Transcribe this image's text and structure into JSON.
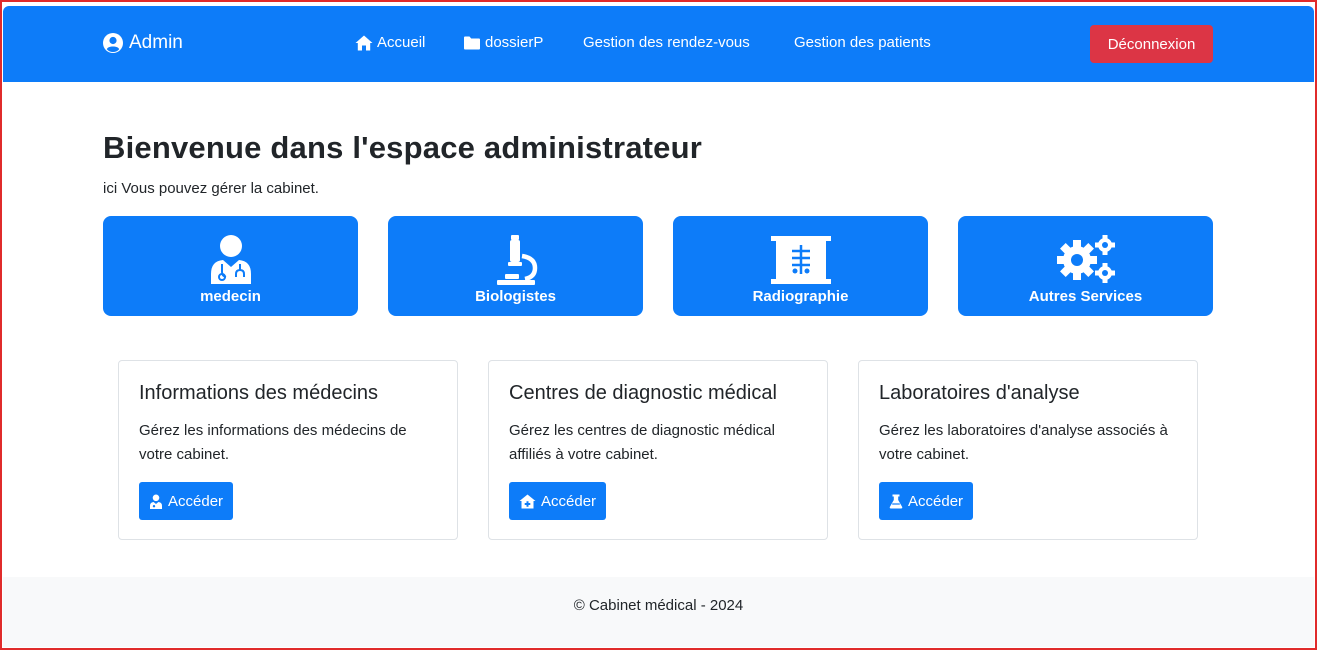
{
  "navbar": {
    "brand": "Admin",
    "links": [
      {
        "label": "Accueil",
        "icon": "home-icon"
      },
      {
        "label": "dossierP",
        "icon": "folder-icon"
      },
      {
        "label": "Gestion des rendez-vous"
      },
      {
        "label": "Gestion des patients"
      }
    ],
    "logout_label": "Déconnexion"
  },
  "main": {
    "title": "Bienvenue dans l'espace administrateur",
    "subtitle": "ici Vous pouvez gérer la cabinet."
  },
  "tiles": [
    {
      "label": "medecin",
      "icon": "doctor-icon"
    },
    {
      "label": "Biologistes",
      "icon": "microscope-icon"
    },
    {
      "label": "Radiographie",
      "icon": "x-ray-icon"
    },
    {
      "label": "Autres Services",
      "icon": "gears-icon"
    }
  ],
  "cards": [
    {
      "title": "Informations des médecins",
      "text": "Gérez les informations des médecins de votre cabinet.",
      "button": "Accéder",
      "icon": "user-doctor-icon"
    },
    {
      "title": "Centres de diagnostic médical",
      "text": "Gérez les centres de diagnostic médical affiliés à votre cabinet.",
      "button": "Accéder",
      "icon": "clinic-icon"
    },
    {
      "title": "Laboratoires d'analyse",
      "text": "Gérez les laboratoires d'analyse associés à votre cabinet.",
      "button": "Accéder",
      "icon": "flask-icon"
    }
  ],
  "footer": {
    "text": "© Cabinet médical - 2024"
  },
  "colors": {
    "primary": "#0d7cf9",
    "danger": "#dc3545",
    "footer_bg": "#f8f9fa"
  }
}
